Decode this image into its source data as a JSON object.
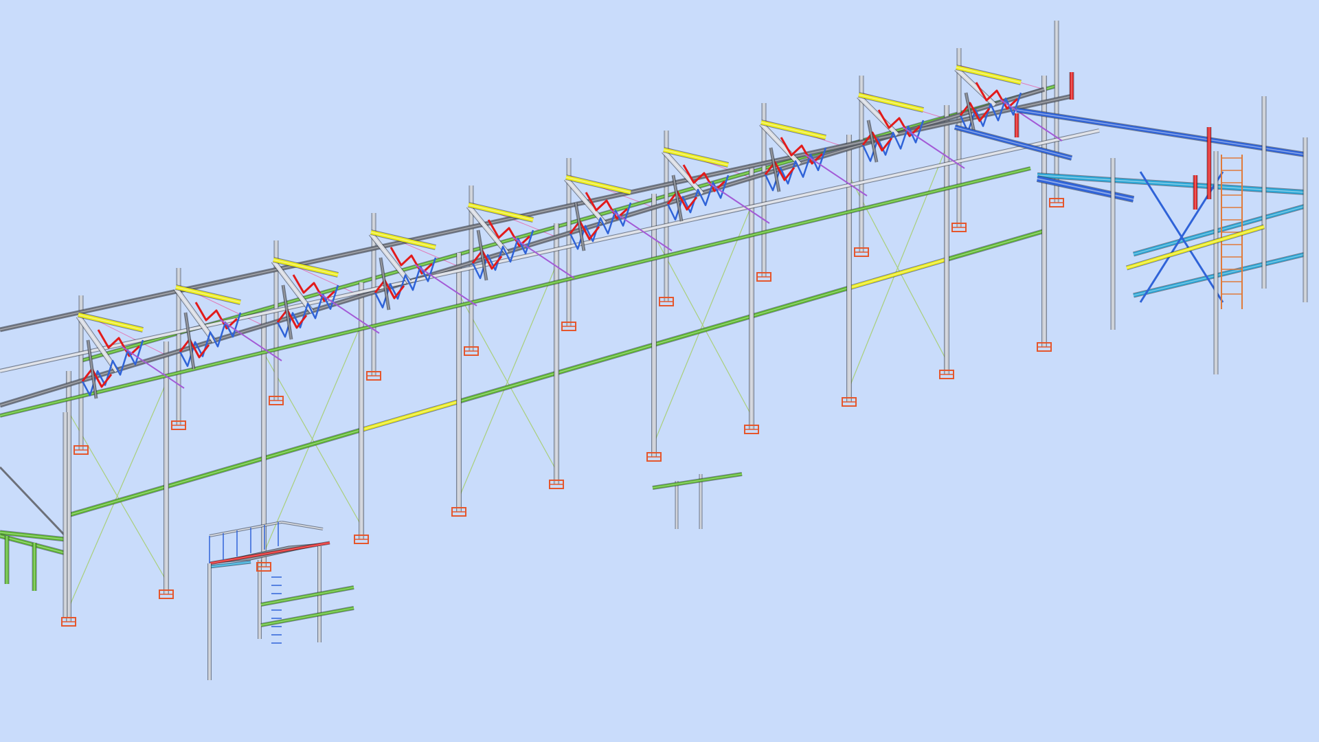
{
  "viewport": {
    "background": "#c9dcfb",
    "description_icon": "3d-steel-structure-model"
  },
  "colors": {
    "column": "#c4c8d0",
    "column_edge": "#7f8590",
    "roof_beam": "#d8dbe2",
    "eave_beam": "#6c7079",
    "green_girt": "#5bb82c",
    "yellow_member": "#ecec1c",
    "red_member": "#e21b1b",
    "blue_brace": "#2f63d8",
    "cyan_member": "#2aa6d6",
    "purple_brace": "#a35ad6",
    "pink_tie": "#e07ab8",
    "thin_brace": "#a9cf7a",
    "base_plate": "#e5562c",
    "platform_floor": "#9aa0aa"
  }
}
